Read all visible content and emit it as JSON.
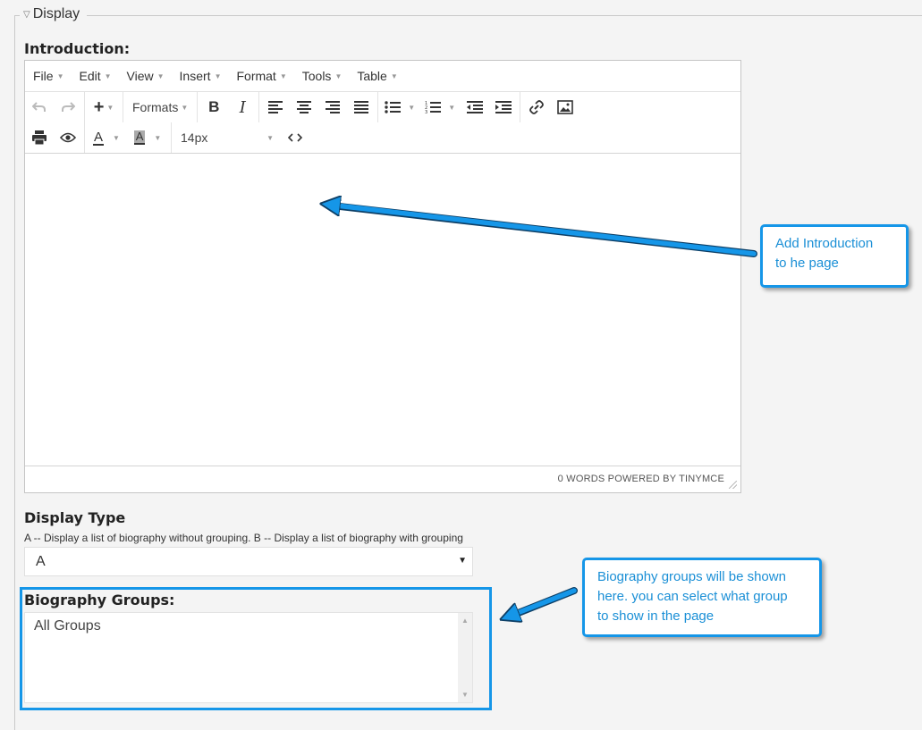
{
  "fieldset": {
    "legend": "Display"
  },
  "introduction": {
    "label": "Introduction:"
  },
  "editor": {
    "menus": [
      "File",
      "Edit",
      "View",
      "Insert",
      "Format",
      "Tools",
      "Table"
    ],
    "formats_label": "Formats",
    "font_size": "14px",
    "status": "0 WORDS POWERED BY TINYMCE"
  },
  "display_type": {
    "label": "Display Type",
    "hint": "A -- Display a list of biography without grouping. B -- Display a list of biography with grouping",
    "selected": "A"
  },
  "biography_groups": {
    "label": "Biography Groups:",
    "options": [
      "All Groups"
    ]
  },
  "callouts": {
    "intro_line1": "Add Introduction",
    "intro_line2": "to he page",
    "groups_line1": "Biography groups will be shown",
    "groups_line2": "here. you can select what group",
    "groups_line3": "to show in the page"
  },
  "colors": {
    "accent": "#1596e8",
    "callout_text": "#1a8fd6"
  }
}
